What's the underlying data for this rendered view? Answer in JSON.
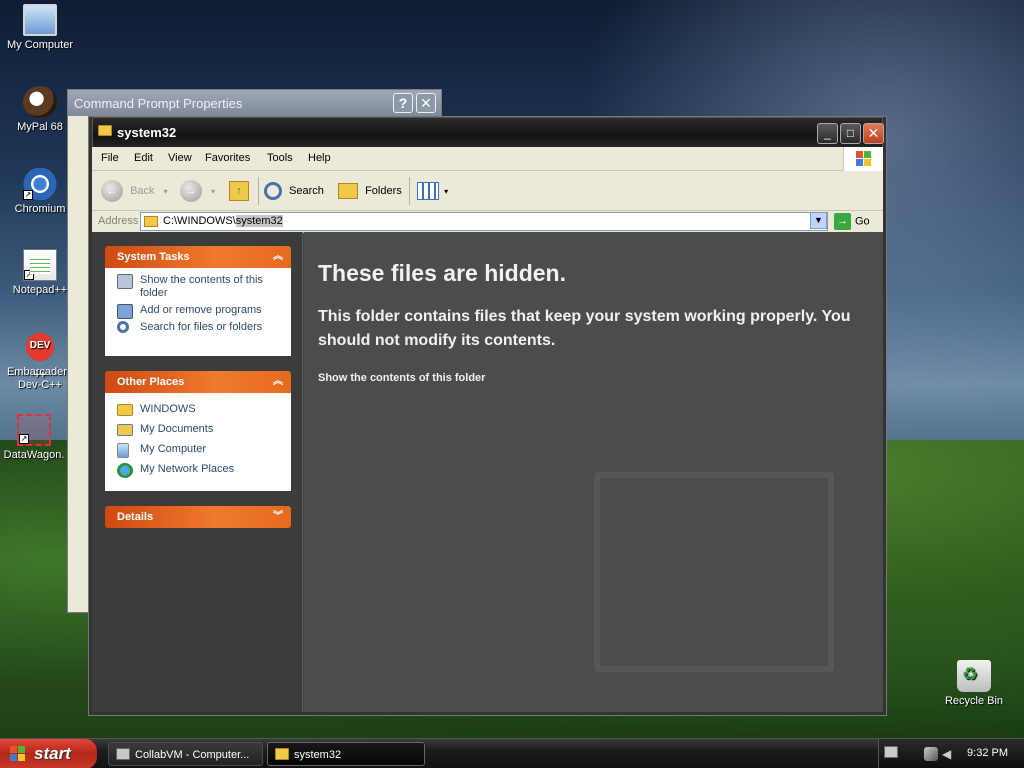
{
  "desktop": {
    "icons": [
      {
        "label": "My Computer"
      },
      {
        "label": "MyPal 68"
      },
      {
        "label": "Chromium"
      },
      {
        "label": "Notepad++"
      },
      {
        "label": "Embarcadero Dev-C++",
        "line1": "Embarcadero",
        "line2": "Dev-C++",
        "glyph": "DEV\n++"
      },
      {
        "label": "DataWagon."
      },
      {
        "label": "Recycle Bin"
      }
    ]
  },
  "background_window": {
    "title": "Command Prompt Properties",
    "help_label": "?",
    "close_label": "✕"
  },
  "window": {
    "title": "system32",
    "controls": {
      "minimize": "_",
      "maximize": "□",
      "close": "✕"
    },
    "menu": [
      "File",
      "Edit",
      "View",
      "Favorites",
      "Tools",
      "Help"
    ],
    "toolbar": {
      "back": "Back",
      "search": "Search",
      "folders": "Folders"
    },
    "address": {
      "label": "Address",
      "path_prefix": "C:\\WINDOWS\\",
      "path_selected": "system32",
      "go": "Go"
    },
    "system_tasks": {
      "title": "System Tasks",
      "items": [
        {
          "label": "Show the contents of this folder"
        },
        {
          "label": "Add or remove programs"
        },
        {
          "label": "Search for files or folders"
        }
      ]
    },
    "other_places": {
      "title": "Other Places",
      "items": [
        {
          "label": "WINDOWS"
        },
        {
          "label": "My Documents"
        },
        {
          "label": "My Computer"
        },
        {
          "label": "My Network Places"
        }
      ]
    },
    "details": {
      "title": "Details"
    },
    "main": {
      "heading": "These files are hidden.",
      "body": "This folder contains files that keep your system working properly. You should not modify its contents.",
      "link": "Show the contents of this folder"
    }
  },
  "taskbar": {
    "start": "start",
    "tasks": [
      {
        "label": "CollabVM - Computer..."
      },
      {
        "label": "system32"
      }
    ],
    "clock": "9:32 PM"
  },
  "colors": {
    "panel_header": "#e56a1f",
    "start_button": "#b42617",
    "link_text": "#2f4a6b"
  }
}
